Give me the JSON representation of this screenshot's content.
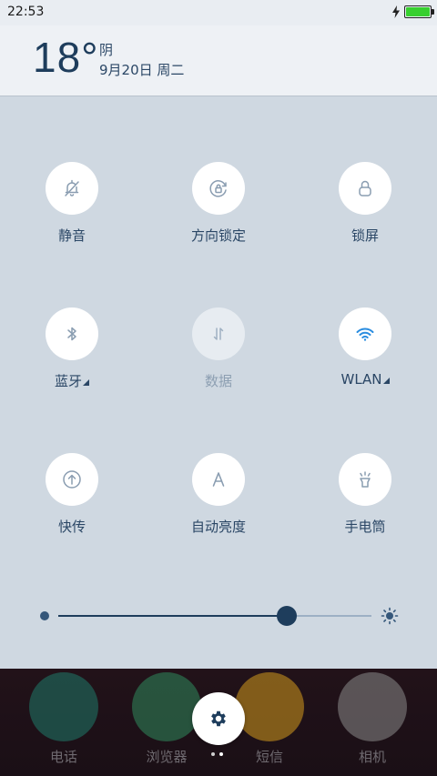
{
  "status_bar": {
    "time": "22:53",
    "battery_level": 1.0,
    "charging": true
  },
  "weather": {
    "temperature": "18°",
    "condition": "阴",
    "date": "9月20日 周二"
  },
  "tiles": [
    {
      "label": "静音",
      "icon": "bell-off-icon",
      "active": true
    },
    {
      "label": "方向锁定",
      "icon": "rotation-lock-icon",
      "active": true
    },
    {
      "label": "锁屏",
      "icon": "lock-icon",
      "active": true
    },
    {
      "label": "蓝牙",
      "icon": "bluetooth-icon",
      "active": true,
      "has_submenu": true
    },
    {
      "label": "数据",
      "icon": "mobile-data-icon",
      "active": false
    },
    {
      "label": "WLAN",
      "icon": "wifi-icon",
      "active": true,
      "has_submenu": true
    },
    {
      "label": "快传",
      "icon": "quick-transfer-icon",
      "active": true
    },
    {
      "label": "自动亮度",
      "icon": "auto-brightness-icon",
      "active": true
    },
    {
      "label": "手电筒",
      "icon": "flashlight-icon",
      "active": true
    }
  ],
  "brightness": {
    "level": 0.73,
    "min_icon": "brightness-low-icon",
    "max_icon": "sun-icon"
  },
  "dock": {
    "apps": [
      {
        "label": "电话",
        "icon": "phone-icon",
        "color": "#1f7a6a"
      },
      {
        "label": "浏览器",
        "icon": "browser-icon",
        "color": "#2f8a5c"
      },
      {
        "label": "短信",
        "icon": "message-icon",
        "color": "#d49a1e"
      },
      {
        "label": "相机",
        "icon": "camera-icon",
        "color": "#8a8a8a"
      }
    ],
    "settings_icon": "gear-icon",
    "page_count": 2,
    "active_page": 1
  },
  "colors": {
    "accent": "#1e3d5c",
    "wifi_active": "#2a8de0",
    "panel_bg": "#cfd8e1"
  }
}
